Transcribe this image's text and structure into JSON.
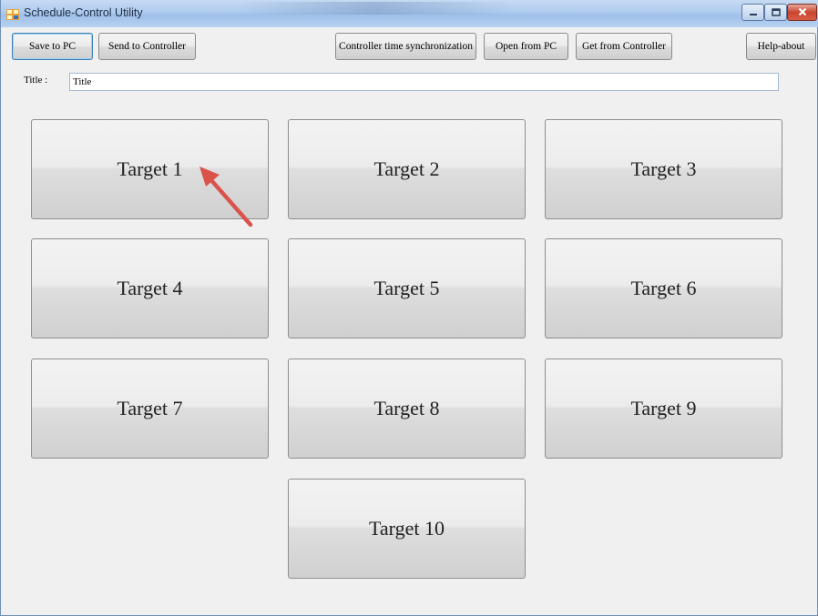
{
  "window": {
    "title": "Schedule-Control Utility",
    "icons": {
      "app": "app-icon",
      "minimize": "minimize-icon",
      "maximize": "maximize-icon",
      "close": "close-icon"
    }
  },
  "toolbar": {
    "save_to_pc": "Save to PC",
    "send_to_controller": "Send to Controller",
    "time_sync": "Controller time synchronization",
    "open_from_pc": "Open from PC",
    "get_from_controller": "Get from Controller",
    "help_about": "Help-about"
  },
  "title_field": {
    "label": "Title :",
    "value": "Title"
  },
  "targets": [
    {
      "label": "Target 1"
    },
    {
      "label": "Target 2"
    },
    {
      "label": "Target 3"
    },
    {
      "label": "Target 4"
    },
    {
      "label": "Target 5"
    },
    {
      "label": "Target 6"
    },
    {
      "label": "Target 7"
    },
    {
      "label": "Target 8"
    },
    {
      "label": "Target 9"
    },
    {
      "label": "Target 10"
    }
  ],
  "annotation": {
    "icon": "arrow-icon",
    "color": "#d9534a"
  },
  "colors": {
    "titlebar": "#b3cdef",
    "window_bg": "#f0f0f0",
    "focus_border": "#3c7fb1"
  }
}
